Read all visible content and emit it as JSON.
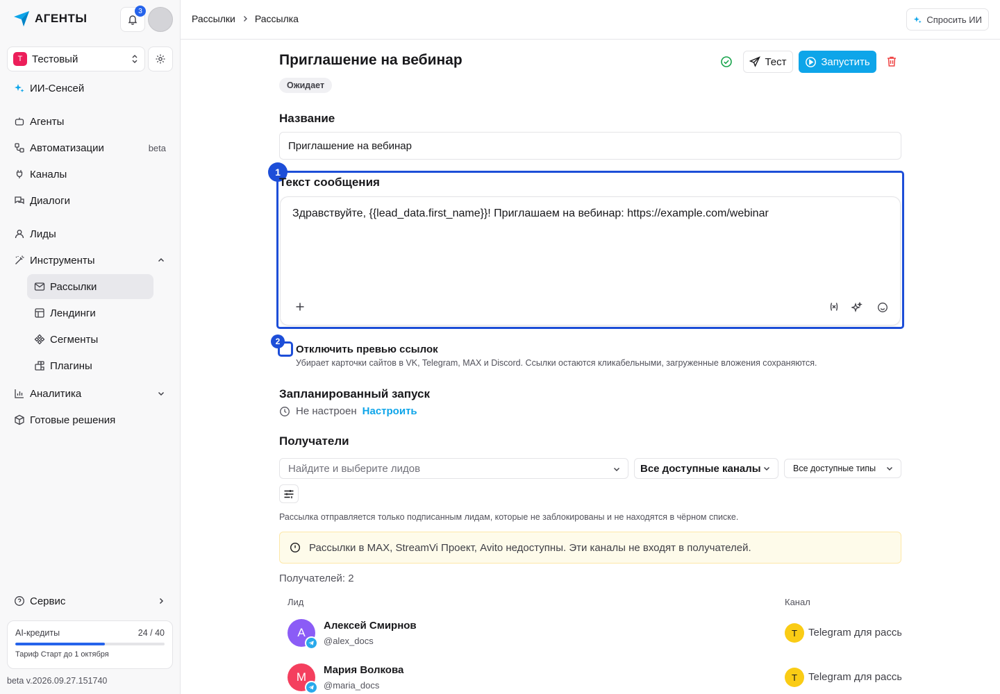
{
  "app": {
    "brand": "АГЕНТЫ",
    "notifications_count": "3"
  },
  "workspace": {
    "letter": "Т",
    "name": "Тестовый"
  },
  "sidebar": {
    "ai_item": "ИИ-Сенсей",
    "items": [
      {
        "label": "Агенты"
      },
      {
        "label": "Автоматизации",
        "badge": "beta"
      },
      {
        "label": "Каналы"
      },
      {
        "label": "Диалоги"
      },
      {
        "label": "Лиды"
      },
      {
        "label": "Инструменты"
      },
      {
        "label": "Рассылки"
      },
      {
        "label": "Лендинги"
      },
      {
        "label": "Сегменты"
      },
      {
        "label": "Плагины"
      },
      {
        "label": "Аналитика"
      },
      {
        "label": "Готовые решения"
      }
    ],
    "service": "Сервис",
    "credits": {
      "label": "AI-кредиты",
      "value": "24 / 40",
      "used_fraction": 0.6,
      "plan": "Тариф Старт до 1 октября"
    },
    "version": "beta v.2026.09.27.151740"
  },
  "topbar": {
    "breadcrumb": [
      "Рассылки",
      "Рассылка"
    ],
    "ask_ai": "Спросить ИИ"
  },
  "campaign": {
    "title": "Приглашение на вебинар",
    "status": "Ожидает",
    "test_label": "Тест",
    "run_label": "Запустить",
    "name_label": "Название",
    "name_value": "Приглашение на вебинар",
    "message_label": "Текст сообщения",
    "message_text": "Здравствуйте, {{lead_data.first_name}}! Приглашаем на вебинар: https://example.com/webinar",
    "highlight_1": "1",
    "highlight_2": "2",
    "disable_preview_label": "Отключить превью ссылок",
    "disable_preview_desc": "Убирает карточки сайтов в VK, Telegram, MAX и Discord. Ссылки остаются кликабельными, загруженные вложения сохраняются.",
    "schedule_label": "Запланированный запуск",
    "schedule_status": "Не настроен",
    "schedule_link": "Настроить",
    "recipients_label": "Получатели",
    "lead_search_placeholder": "Найдите и выберите лидов",
    "channels_select": "Все доступные каналы",
    "types_select": "Все доступные типы",
    "recipients_note": "Рассылка отправляется только подписанным лидам, которые не заблокированы и не находятся в чёрном списке.",
    "warning": "Рассылки в MAX, StreamVi Проект, Avito недоступны. Эти каналы не входят в получателей.",
    "recipients_count": "Получателей: 2",
    "table_headers": {
      "lead": "Лид",
      "channel": "Канал"
    },
    "rows": [
      {
        "initial": "А",
        "name": "Алексей Смирнов",
        "handle": "@alex_docs",
        "channel_letter": "T",
        "channel": "Telegram для рассылок",
        "color": "#8b5cf6"
      },
      {
        "initial": "М",
        "name": "Мария Волкова",
        "handle": "@maria_docs",
        "channel_letter": "T",
        "channel": "Telegram для рассылок",
        "color": "#f43f5e"
      }
    ]
  },
  "colors": {
    "accent": "#0ea5e9",
    "highlight": "#1d4ed8",
    "danger": "#ef4444",
    "success": "#16a34a",
    "brand": "#0ea5e9"
  }
}
